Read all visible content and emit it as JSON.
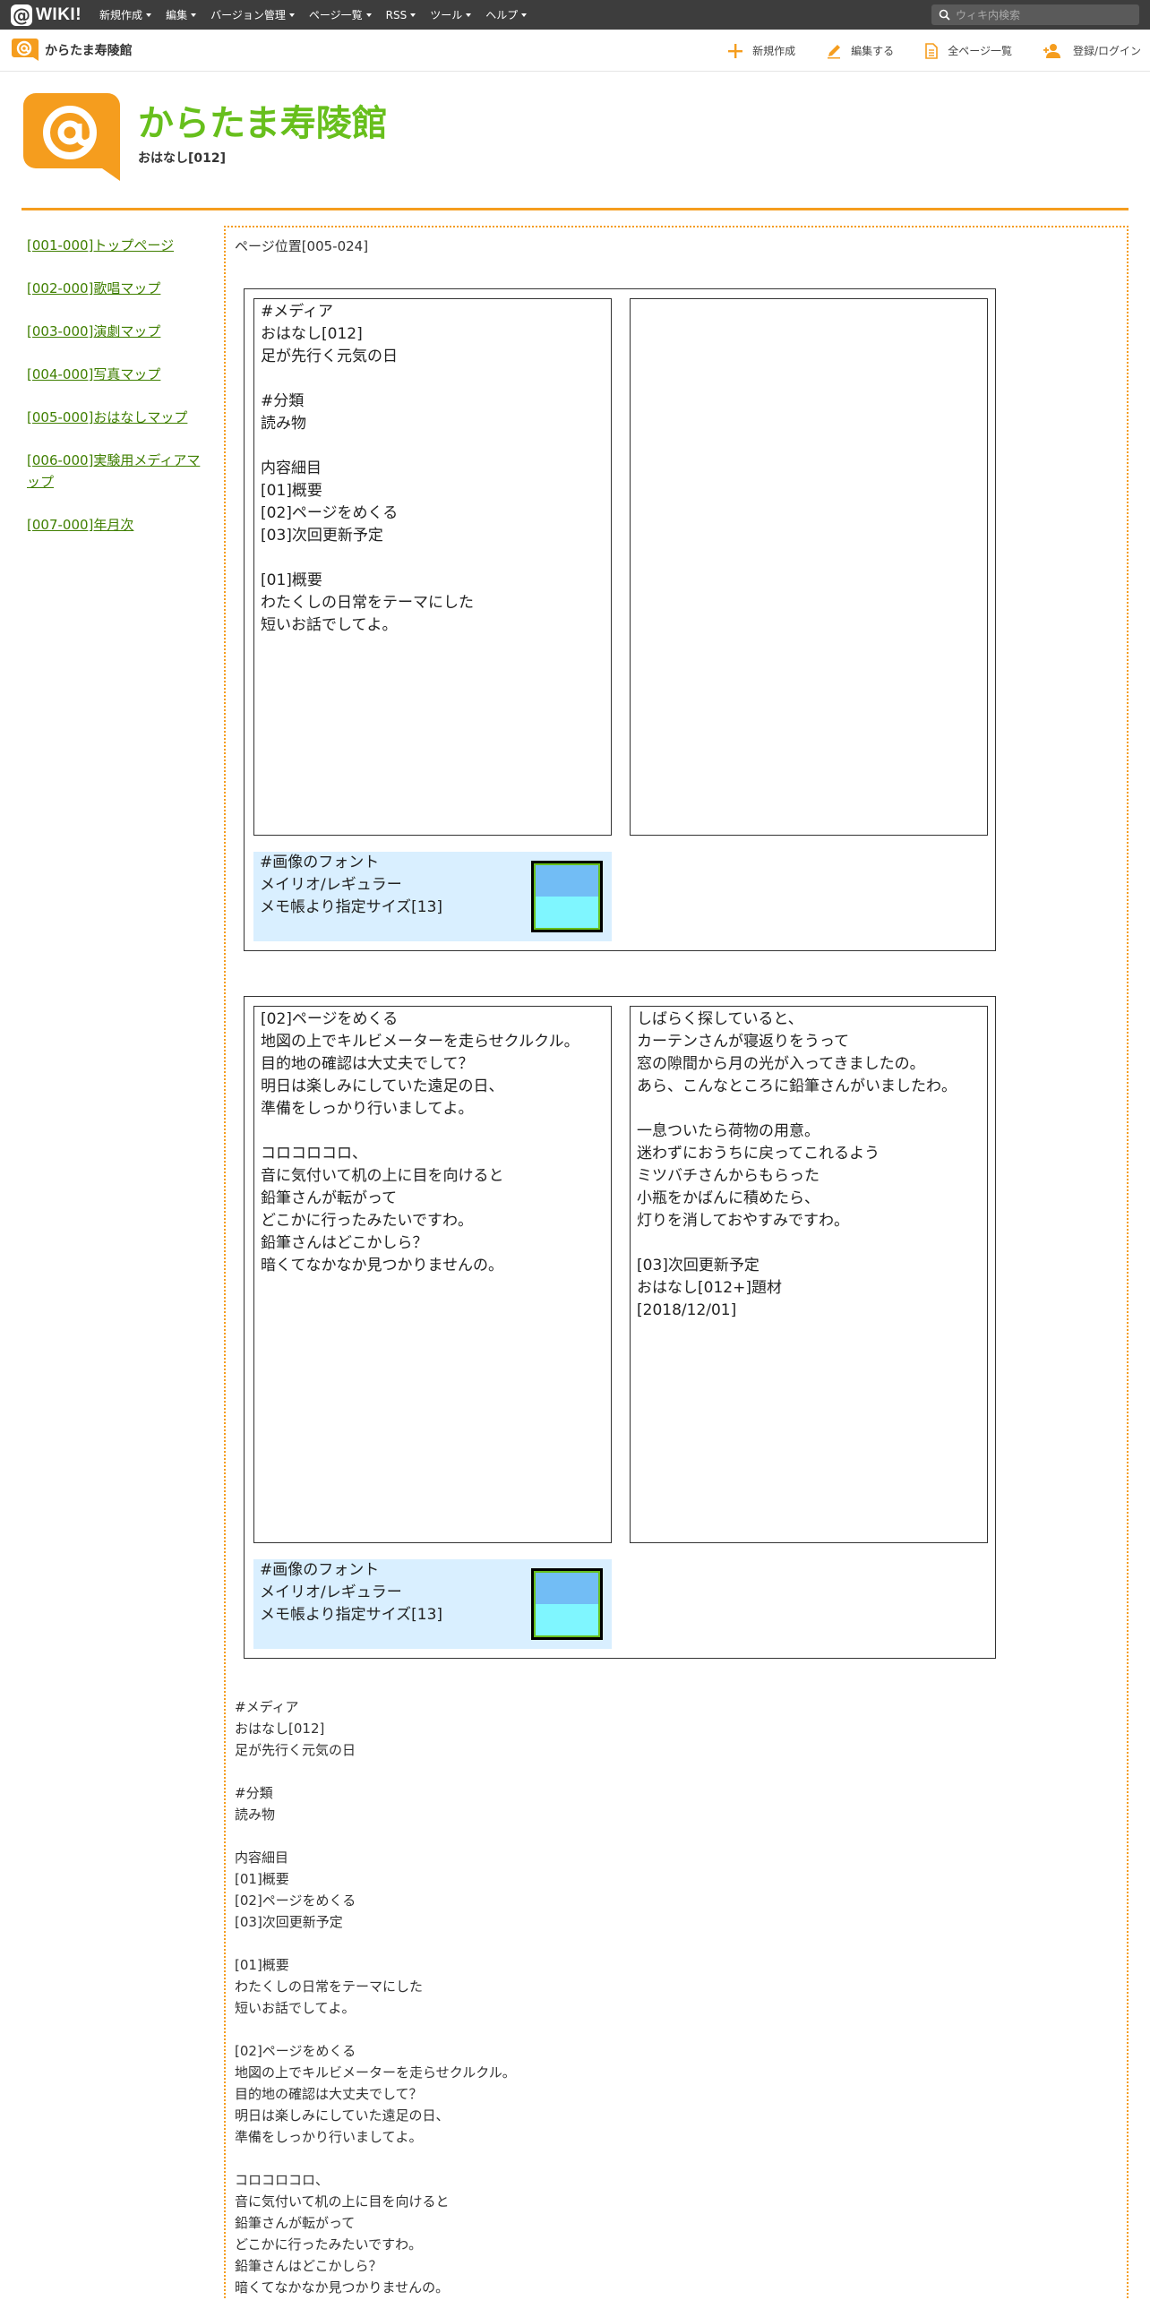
{
  "topbar": {
    "logo_text": "WIKI!",
    "menu": [
      "新規作成",
      "編集",
      "バージョン管理",
      "ページ一覧",
      "RSS",
      "ツール",
      "ヘルプ"
    ],
    "search_placeholder": "ウィキ内検索"
  },
  "subbar": {
    "site_name": "からたま寿陵館",
    "actions": [
      "新規作成",
      "編集する",
      "全ページ一覧",
      "登録/ログイン"
    ]
  },
  "header": {
    "title": "からたま寿陵館",
    "subtitle": "おはなし[012]"
  },
  "sidebar": {
    "items": [
      "[001-000]トップページ",
      "[002-000]歌唱マップ",
      "[003-000]演劇マップ",
      "[004-000]写真マップ",
      "[005-000]おはなしマップ",
      "[006-000]実験用メディアマップ",
      "[007-000]年月次"
    ]
  },
  "main": {
    "page_position": "ページ位置[005-024]",
    "frame1": {
      "left_text": "#メディア\nおはなし[012]\n足が先行く元気の日\n\n#分類\n読み物\n\n内容細目\n[01]概要\n[02]ページをめくる\n[03]次回更新予定\n\n[01]概要\nわたくしの日常をテーマにした\n短いお話でしてよ。",
      "right_text": "",
      "font_box": "#画像のフォント\nメイリオ/レギュラー\nメモ帳より指定サイズ[13]"
    },
    "frame2": {
      "left_text": "[02]ページをめくる\n地図の上でキルビメーターを走らせクルクル。\n目的地の確認は大丈夫でして？\n明日は楽しみにしていた遠足の日、\n準備をしっかり行いましてよ。\n\nコロコロコロ、\n音に気付いて机の上に目を向けると\n鉛筆さんが転がって\nどこかに行ったみたいですわ。\n鉛筆さんはどこかしら？\n暗くてなかなか見つかりませんの。",
      "right_text": "しばらく探していると、\nカーテンさんが寝返りをうって\n窓の隙間から月の光が入ってきましたの。\nあら、こんなところに鉛筆さんがいましたわ。\n\n一息ついたら荷物の用意。\n迷わずにおうちに戻ってこれるよう\nミツバチさんからもらった\n小瓶をかばんに積めたら、\n灯りを消しておやすみですわ。\n\n[03]次回更新予定\nおはなし[012+]題材\n[2018/12/01]",
      "font_box": "#画像のフォント\nメイリオ/レギュラー\nメモ帳より指定サイズ[13]"
    },
    "bottom_text": "#メディア\nおはなし[012]\n足が先行く元気の日\n\n#分類\n読み物\n\n内容細目\n[01]概要\n[02]ページをめくる\n[03]次回更新予定\n\n[01]概要\nわたくしの日常をテーマにした\n短いお話でしてよ。\n\n[02]ページをめくる\n地図の上でキルビメーターを走らせクルクル。\n目的地の確認は大丈夫でして？\n明日は楽しみにしていた遠足の日、\n準備をしっかり行いましてよ。\n\nコロコロコロ、\n音に気付いて机の上に目を向けると\n鉛筆さんが転がって\nどこかに行ったみたいですわ。\n鉛筆さんはどこかしら？\n暗くてなかなか見つかりませんの。"
  },
  "colors": {
    "topbar": "#3d3d3d",
    "accent_orange": "#f59d1e",
    "title_green": "#67bf1c",
    "link_green": "#3f7f00",
    "font_box_bg": "#d9efff",
    "swatch_top": "#72bdf5",
    "swatch_bottom": "#7ff6ff"
  },
  "icons": [
    "search-icon",
    "plus-icon",
    "pencil-icon",
    "document-icon",
    "add-user-icon",
    "at-logo-icon"
  ]
}
